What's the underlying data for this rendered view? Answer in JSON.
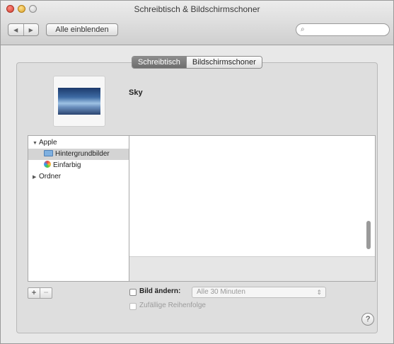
{
  "window": {
    "title": "Schreibtisch & Bildschirmschoner"
  },
  "toolbar": {
    "back_icon": "◀",
    "forward_icon": "▶",
    "show_all_label": "Alle einblenden",
    "search_icon": "⌕",
    "search_value": ""
  },
  "tabs": [
    {
      "label": "Schreibtisch",
      "active": true
    },
    {
      "label": "Bildschirmschoner",
      "active": false
    }
  ],
  "preview": {
    "name": "Sky"
  },
  "sources": [
    {
      "label": "Apple",
      "expander": "▼",
      "indent": 0
    },
    {
      "label": "Hintergrundbilder",
      "icon": "folder-icon",
      "indent": 1,
      "selected": true
    },
    {
      "label": "Einfarbig",
      "icon": "color-wheel-icon",
      "indent": 1
    },
    {
      "label": "Ordner",
      "expander": "▶",
      "indent": 0
    }
  ],
  "controls": {
    "add_label": "+",
    "remove_label": "−",
    "change_picture_label": "Bild ändern:",
    "interval_value": "Alle 30 Minuten",
    "random_order_label": "Zufällige Reihenfolge",
    "help_label": "?"
  }
}
